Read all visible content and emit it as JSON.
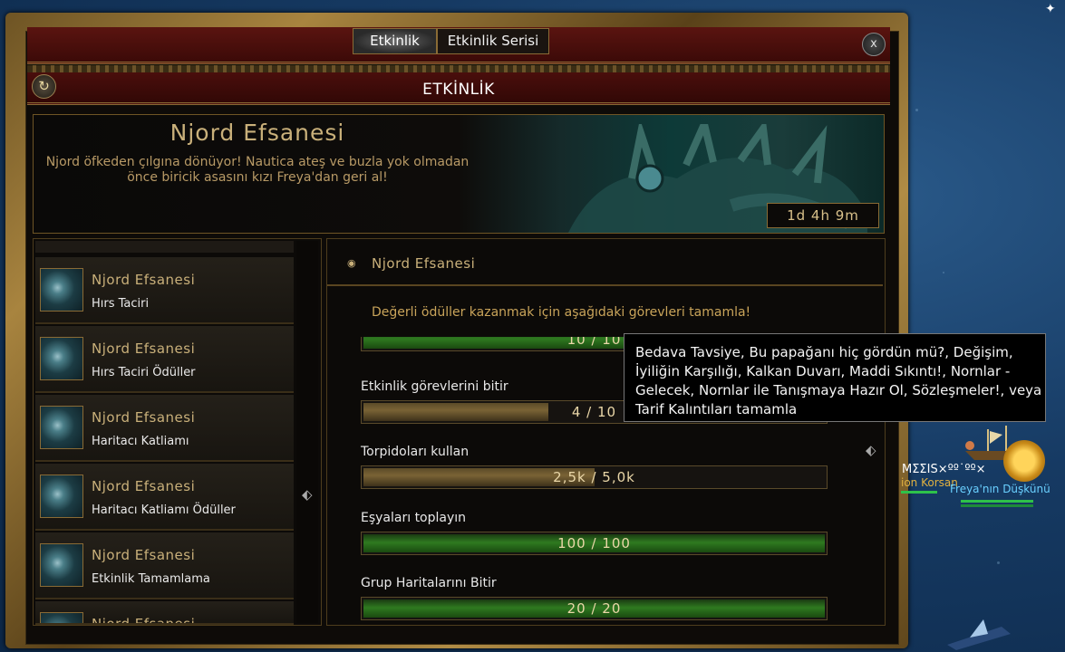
{
  "window": {
    "tabs": [
      {
        "label": "Etkinlik",
        "active": true
      },
      {
        "label": "Etkinlik Serisi",
        "active": false
      }
    ],
    "close_label": "x",
    "refresh_icon": "refresh-icon",
    "header_title": "ETKİNLİK"
  },
  "banner": {
    "title": "Njord Efsanesi",
    "description_line1": "Njord öfkeden çılgına dönüyor! Nautica ateş ve buzla yok olmadan",
    "description_line2": "önce biricik asasını kızı Freya'dan geri al!",
    "timer": "1d 4h 9m"
  },
  "event_list": [
    {
      "title": "Njord Efsanesi",
      "subtitle": "Hırs Taciri"
    },
    {
      "title": "Njord Efsanesi",
      "subtitle": "Hırs Taciri Ödüller"
    },
    {
      "title": "Njord Efsanesi",
      "subtitle": "Haritacı Katliamı"
    },
    {
      "title": "Njord Efsanesi",
      "subtitle": "Haritacı Katliamı Ödüller"
    },
    {
      "title": "Njord Efsanesi",
      "subtitle": "Etkinlik Tamamlama"
    },
    {
      "title": "Njord Efsanesi",
      "subtitle": ""
    }
  ],
  "details": {
    "title": "Njord Efsanesi",
    "intro": "Değerli ödüller kazanmak için aşağıdaki görevleri tamamla!",
    "partial_bar_text": "10 / 10",
    "tasks": [
      {
        "label": "Etkinlik görevlerini bitir",
        "progress_text": "4 / 10",
        "fraction": 0.4,
        "style": "gold"
      },
      {
        "label": "Torpidoları kullan",
        "progress_text": "2,5k / 5,0k",
        "fraction": 0.5,
        "style": "gold"
      },
      {
        "label": "Eşyaları toplayın",
        "progress_text": "100 / 100",
        "fraction": 1.0,
        "style": "green"
      },
      {
        "label": "Grup Haritalarını Bitir",
        "progress_text": "20 / 20",
        "fraction": 1.0,
        "style": "green"
      }
    ]
  },
  "tooltip": {
    "text": "Bedava Tavsiye, Bu papağanı hiç gördün mü?, Değişim, İyiliğin Karşılığı, Kalkan Duvarı, Maddi Sıkıntı!, Nornlar - Gelecek, Nornlar ile Tanışmaya Hazır Ol, Sözleşmeler!, veya Tarif Kalıntıları tamamla"
  },
  "world": {
    "player_name_partial": "MΣΣIS×ºº˙ºº×",
    "clan_partial": "ion Korsan",
    "npc_name": "Freya'nın Düşkünü"
  },
  "colors": {
    "gold_text": "#c9b07a",
    "frame_gold": "#a8843f",
    "header_red": "#4a0e0c",
    "bar_green": "#2f7a20"
  }
}
